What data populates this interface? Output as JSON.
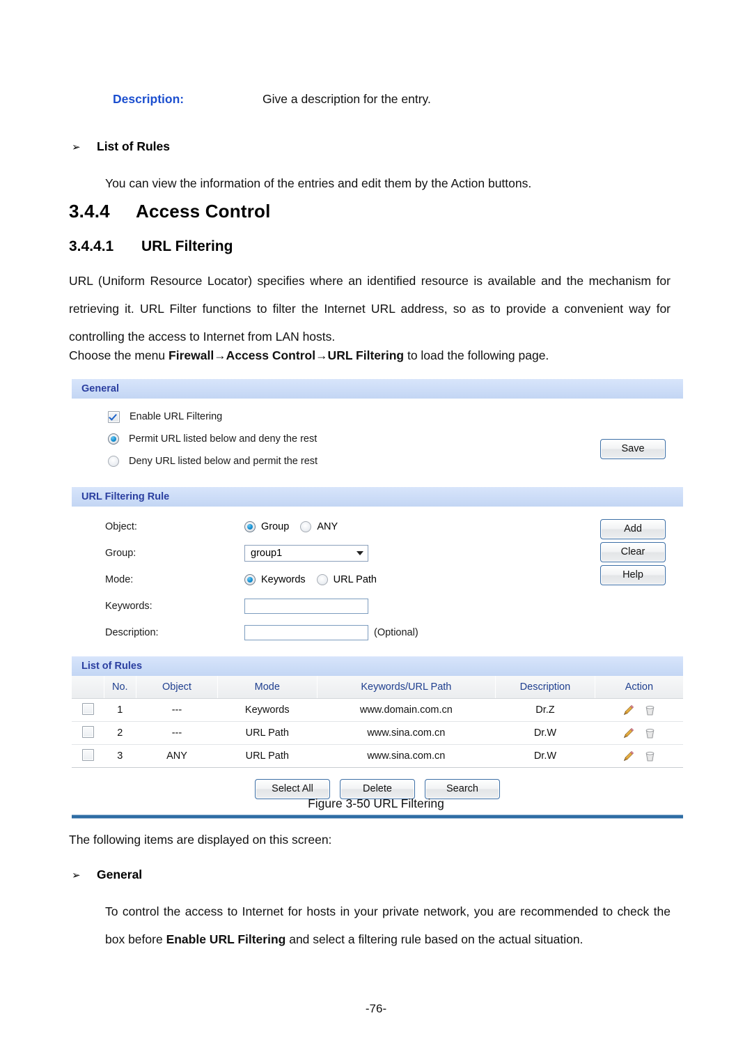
{
  "document": {
    "description_label": "Description:",
    "description_text": "Give a description for the entry.",
    "bullet_list_of_rules": "List of Rules",
    "list_of_rules_text": "You can view the information of the entries and edit them by the Action buttons.",
    "section_number": "3.4.4",
    "section_title": "Access Control",
    "subsection_number": "3.4.4.1",
    "subsection_title": "URL Filtering",
    "paragraph_1": "URL (Uniform Resource Locator) specifies where an identified resource is available and the mechanism for retrieving it. URL Filter functions to filter the Internet URL address, so as to provide a convenient way for controlling the access to Internet from LAN hosts.",
    "choose_menu_prefix": "Choose the menu ",
    "choose_menu_path": "Firewall→Access Control→URL Filtering",
    "choose_menu_suffix": " to load the following page.",
    "figure_caption": "Figure 3-50 URL Filtering",
    "following_items_text": "The following items are displayed on this screen:",
    "bullet_general": "General",
    "general_paragraph_prefix": "To control the access to Internet for hosts in your private network, you are recommended to check the box before ",
    "general_paragraph_bold": "Enable URL Filtering",
    "general_paragraph_suffix": " and select a filtering rule based on the actual situation.",
    "page_number": "-76-",
    "bullet_glyph": "➢"
  },
  "ui": {
    "general": {
      "header": "General",
      "enable_label": "Enable URL Filtering",
      "enable_checked": true,
      "radio_permit": "Permit URL listed below and deny the rest",
      "radio_deny": "Deny URL listed below and permit the rest",
      "selected_rule": "permit",
      "save_button": "Save"
    },
    "rule": {
      "header": "URL Filtering Rule",
      "object_label": "Object:",
      "object_option_group": "Group",
      "object_option_any": "ANY",
      "object_selected": "Group",
      "group_label": "Group:",
      "group_value": "group1",
      "mode_label": "Mode:",
      "mode_option_keywords": "Keywords",
      "mode_option_urlpath": "URL Path",
      "mode_selected": "Keywords",
      "keywords_label": "Keywords:",
      "keywords_value": "",
      "description_label": "Description:",
      "description_value": "",
      "optional_note": "(Optional)",
      "add_button": "Add",
      "clear_button": "Clear",
      "help_button": "Help"
    },
    "list": {
      "header": "List of Rules",
      "columns": [
        "",
        "No.",
        "Object",
        "Mode",
        "Keywords/URL Path",
        "Description",
        "Action"
      ],
      "rows": [
        {
          "no": "1",
          "object": "---",
          "mode": "Keywords",
          "keywords": "www.domain.com.cn",
          "description": "Dr.Z"
        },
        {
          "no": "2",
          "object": "---",
          "mode": "URL Path",
          "keywords": "www.sina.com.cn",
          "description": "Dr.W"
        },
        {
          "no": "3",
          "object": "ANY",
          "mode": "URL Path",
          "keywords": "www.sina.com.cn",
          "description": "Dr.W"
        }
      ],
      "select_all_button": "Select All",
      "delete_button": "Delete",
      "search_button": "Search"
    },
    "colors": {
      "section_bar_bg": "#c3d6f4",
      "section_bar_text": "#2b3fa0",
      "table_header_text": "#1f3f8f",
      "button_border": "#3b6ea5",
      "radio_dot": "#1792d4",
      "footer_rule": "#2e6da4",
      "doc_label_blue": "#1c4fcf"
    }
  }
}
